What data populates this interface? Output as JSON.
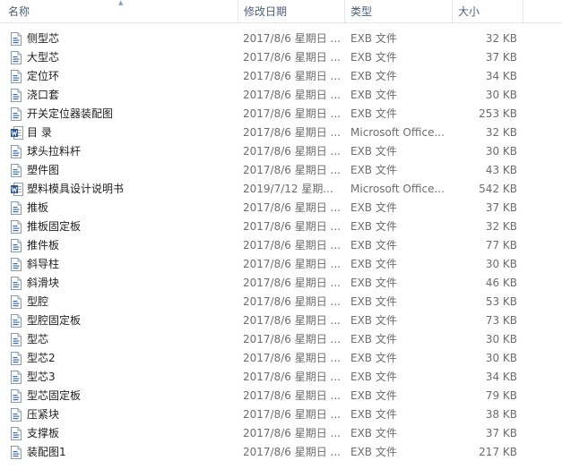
{
  "columns": {
    "name": "名称",
    "date": "修改日期",
    "type": "类型",
    "size": "大小"
  },
  "files": [
    {
      "name": "侧型芯",
      "date": "2017/8/6 星期日 ...",
      "type": "EXB 文件",
      "size": "32 KB",
      "icon": "exb-file-icon"
    },
    {
      "name": "大型芯",
      "date": "2017/8/6 星期日 ...",
      "type": "EXB 文件",
      "size": "37 KB",
      "icon": "exb-file-icon"
    },
    {
      "name": "定位环",
      "date": "2017/8/6 星期日 ...",
      "type": "EXB 文件",
      "size": "34 KB",
      "icon": "exb-file-icon"
    },
    {
      "name": "浇口套",
      "date": "2017/8/6 星期日 ...",
      "type": "EXB 文件",
      "size": "30 KB",
      "icon": "exb-file-icon"
    },
    {
      "name": "开关定位器装配图",
      "date": "2017/8/6 星期日 ...",
      "type": "EXB 文件",
      "size": "253 KB",
      "icon": "exb-file-icon"
    },
    {
      "name": "目  录",
      "date": "2017/8/6 星期日 ...",
      "type": "Microsoft Office...",
      "size": "32 KB",
      "icon": "word-document-icon"
    },
    {
      "name": "球头拉料杆",
      "date": "2017/8/6 星期日 ...",
      "type": "EXB 文件",
      "size": "30 KB",
      "icon": "exb-file-icon"
    },
    {
      "name": "塑件图",
      "date": "2017/8/6 星期日 ...",
      "type": "EXB 文件",
      "size": "43 KB",
      "icon": "exb-file-icon"
    },
    {
      "name": "塑料模具设计说明书",
      "date": "2019/7/12 星期...",
      "type": "Microsoft Office...",
      "size": "542 KB",
      "icon": "word-document-icon"
    },
    {
      "name": "推板",
      "date": "2017/8/6 星期日 ...",
      "type": "EXB 文件",
      "size": "37 KB",
      "icon": "exb-file-icon"
    },
    {
      "name": "推板固定板",
      "date": "2017/8/6 星期日 ...",
      "type": "EXB 文件",
      "size": "32 KB",
      "icon": "exb-file-icon"
    },
    {
      "name": "推件板",
      "date": "2017/8/6 星期日 ...",
      "type": "EXB 文件",
      "size": "77 KB",
      "icon": "exb-file-icon"
    },
    {
      "name": "斜导柱",
      "date": "2017/8/6 星期日 ...",
      "type": "EXB 文件",
      "size": "30 KB",
      "icon": "exb-file-icon"
    },
    {
      "name": "斜滑块",
      "date": "2017/8/6 星期日 ...",
      "type": "EXB 文件",
      "size": "46 KB",
      "icon": "exb-file-icon"
    },
    {
      "name": "型腔",
      "date": "2017/8/6 星期日 ...",
      "type": "EXB 文件",
      "size": "53 KB",
      "icon": "exb-file-icon"
    },
    {
      "name": "型腔固定板",
      "date": "2017/8/6 星期日 ...",
      "type": "EXB 文件",
      "size": "73 KB",
      "icon": "exb-file-icon"
    },
    {
      "name": "型芯",
      "date": "2017/8/6 星期日 ...",
      "type": "EXB 文件",
      "size": "30 KB",
      "icon": "exb-file-icon"
    },
    {
      "name": "型芯2",
      "date": "2017/8/6 星期日 ...",
      "type": "EXB 文件",
      "size": "30 KB",
      "icon": "exb-file-icon"
    },
    {
      "name": "型芯3",
      "date": "2017/8/6 星期日 ...",
      "type": "EXB 文件",
      "size": "34 KB",
      "icon": "exb-file-icon"
    },
    {
      "name": "型芯固定板",
      "date": "2017/8/6 星期日 ...",
      "type": "EXB 文件",
      "size": "79 KB",
      "icon": "exb-file-icon"
    },
    {
      "name": "压紧块",
      "date": "2017/8/6 星期日 ...",
      "type": "EXB 文件",
      "size": "38 KB",
      "icon": "exb-file-icon"
    },
    {
      "name": "支撑板",
      "date": "2017/8/6 星期日 ...",
      "type": "EXB 文件",
      "size": "37 KB",
      "icon": "exb-file-icon"
    },
    {
      "name": "装配图1",
      "date": "2017/8/6 星期日 ...",
      "type": "EXB 文件",
      "size": "217 KB",
      "icon": "exb-file-icon"
    }
  ],
  "colors": {
    "header_text": "#4c607a",
    "name_text": "#1e1e1e",
    "meta_text": "#6d6d6d",
    "exb_icon_accent": "#3a6fb0",
    "word_icon_accent": "#2b5797"
  }
}
